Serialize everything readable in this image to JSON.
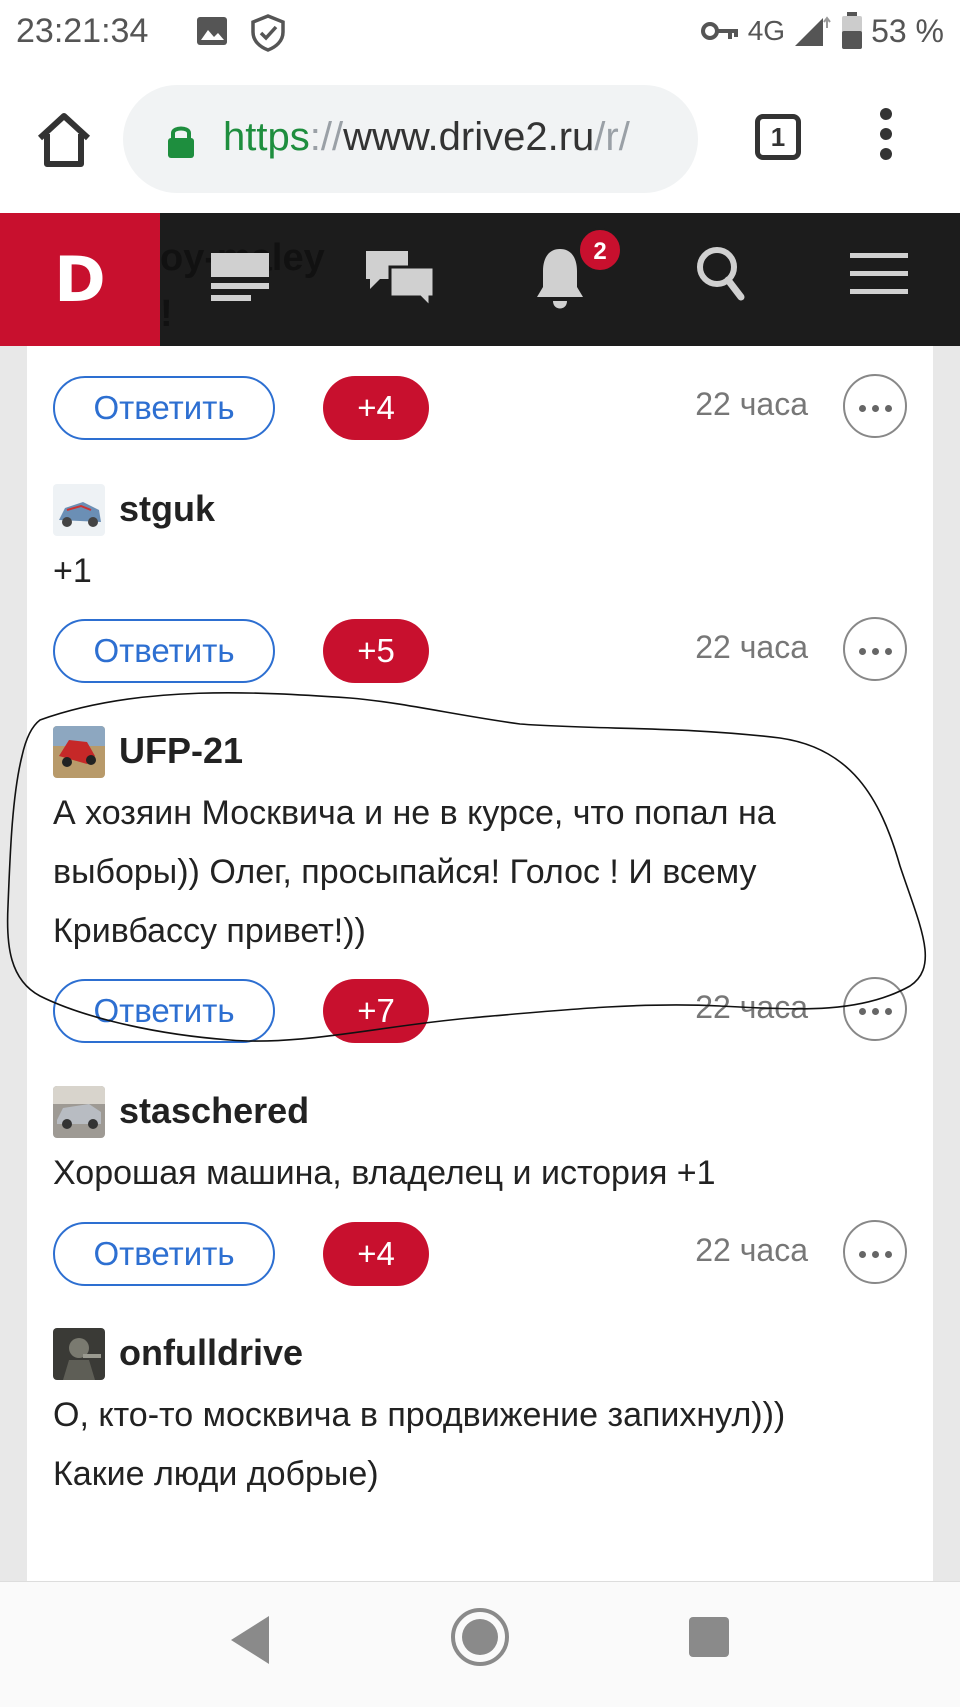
{
  "status_bar": {
    "time": "23:21:34",
    "network": "4G",
    "battery": "53 %"
  },
  "browser": {
    "url_https": "https",
    "url_sep": "://",
    "url_host": "www.drive2.ru",
    "url_tail": "/r/",
    "tab_count": "1"
  },
  "site": {
    "logo": "D",
    "ghost_name": "oy-maley",
    "ghost_line": "!",
    "notification_count": "2"
  },
  "comments": [
    {
      "id": "prev",
      "reply_label": "Ответить",
      "votes": "+4",
      "time": "22 часа"
    },
    {
      "id": "stguk",
      "username": "stguk",
      "text": "+1",
      "reply_label": "Ответить",
      "votes": "+5",
      "time": "22 часа"
    },
    {
      "id": "ufp21",
      "username": "UFP-21",
      "text": "А хозяин Москвича и не в курсе, что попал на выборы)) Олег, просыпайся! Голос ! И всему Кривбассу привет!))",
      "reply_label": "Ответить",
      "votes": "+7",
      "time": "22 часа"
    },
    {
      "id": "staschered",
      "username": "staschered",
      "text": "Хорошая машина, владелец и история +1",
      "reply_label": "Ответить",
      "votes": "+4",
      "time": "22 часа"
    },
    {
      "id": "onfulldrive",
      "username": "onfulldrive",
      "text_line1": "О, кто-то москвича в продвижение запихнул)))",
      "text_line2": "Какие люди добрые)"
    }
  ]
}
